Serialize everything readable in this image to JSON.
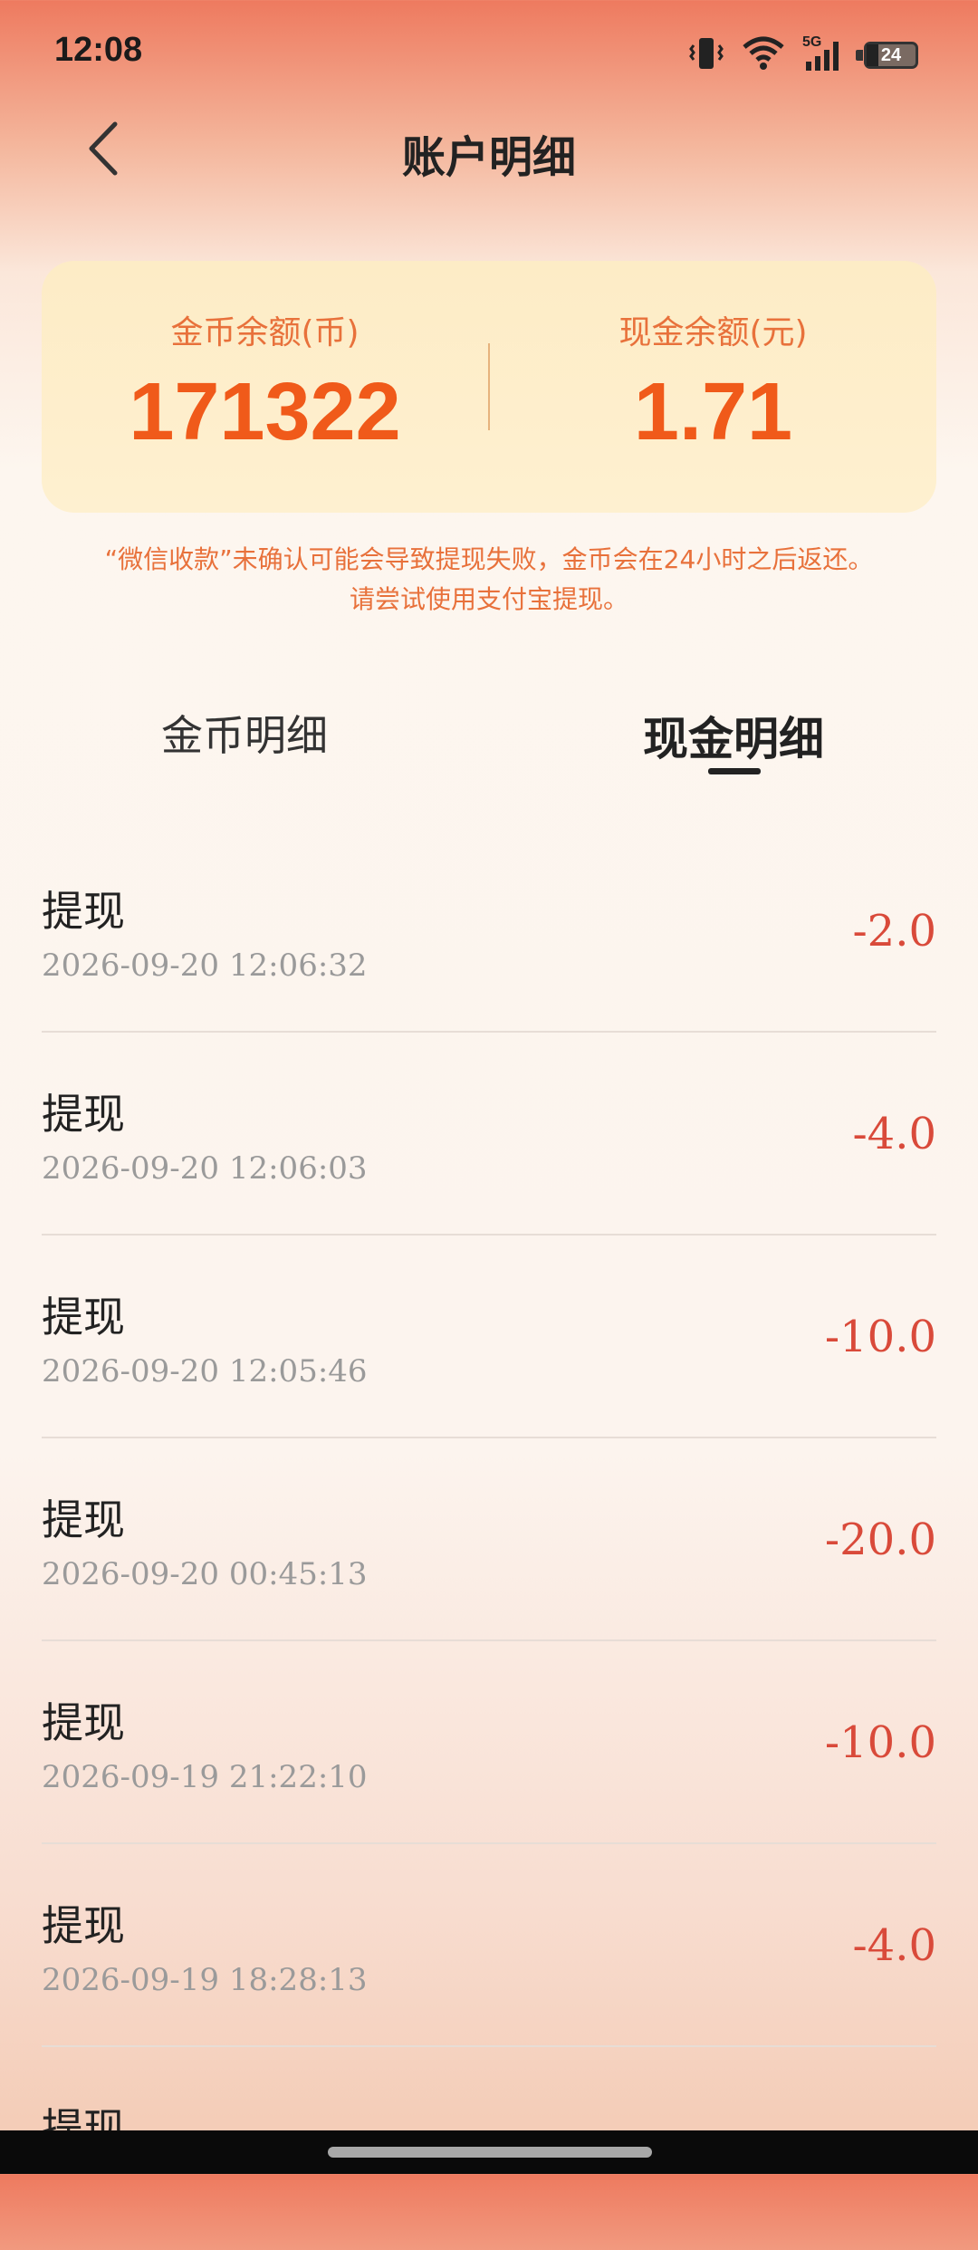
{
  "status_bar": {
    "time": "12:08",
    "battery": "24",
    "network": "5G"
  },
  "header": {
    "title": "账户明细"
  },
  "balances": {
    "coins_label": "金币余额(币)",
    "coins_value": "171322",
    "cash_label": "现金余额(元)",
    "cash_value": "1.71"
  },
  "notice": {
    "line1": "“微信收款”未确认可能会导致提现失败，金币会在24小时之后返还。",
    "line2": "请尝试使用支付宝提现。"
  },
  "tabs": [
    {
      "label": "金币明细",
      "active": false
    },
    {
      "label": "现金明细",
      "active": true
    }
  ],
  "transactions": [
    {
      "title": "提现",
      "time": "2026-09-20 12:06:32",
      "amount": "-2.0"
    },
    {
      "title": "提现",
      "time": "2026-09-20 12:06:03",
      "amount": "-4.0"
    },
    {
      "title": "提现",
      "time": "2026-09-20 12:05:46",
      "amount": "-10.0"
    },
    {
      "title": "提现",
      "time": "2026-09-20 00:45:13",
      "amount": "-20.0"
    },
    {
      "title": "提现",
      "time": "2026-09-19 21:22:10",
      "amount": "-10.0"
    },
    {
      "title": "提现",
      "time": "2026-09-19 18:28:13",
      "amount": "-4.0"
    },
    {
      "title": "提现",
      "time": "",
      "amount": ""
    }
  ],
  "colors": {
    "accent": "#f05a1a",
    "amount": "#d94a3a",
    "card_bg": "#fdecc6"
  }
}
